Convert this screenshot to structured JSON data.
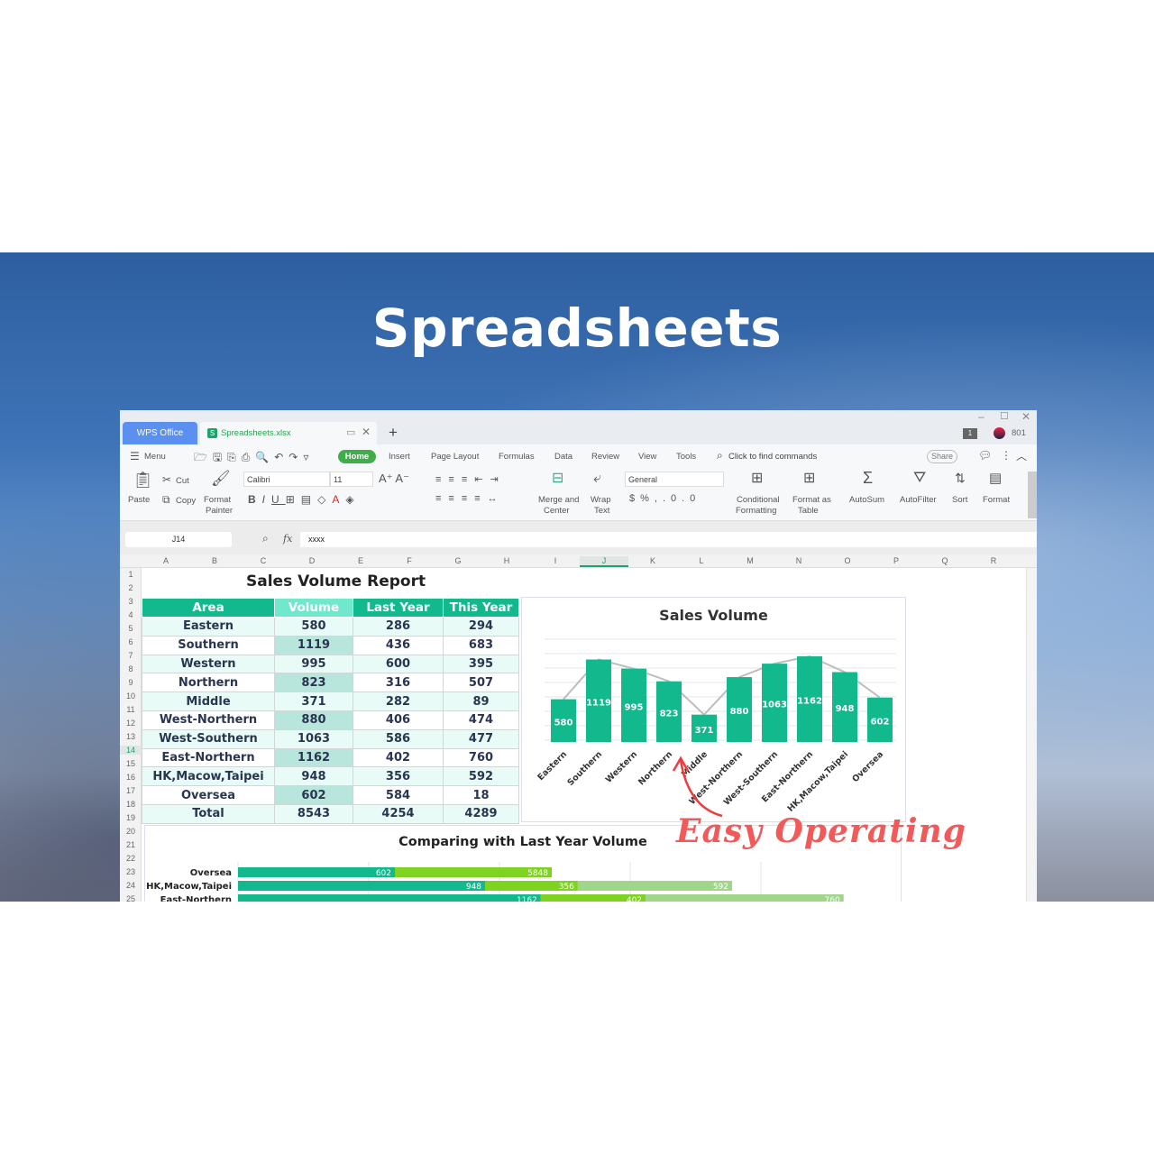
{
  "hero_title": "Spreadsheets",
  "window": {
    "tabs": {
      "home_tab": "WPS Office",
      "file_tab": "Spreadsheets.xlsx",
      "new_tab": "+"
    },
    "user_count": "801",
    "window_badge": "1",
    "menu": {
      "menu_label": "Menu",
      "items": [
        "Home",
        "Insert",
        "Page Layout",
        "Formulas",
        "Data",
        "Review",
        "View",
        "Tools"
      ],
      "active": "Home",
      "search": "Click to find commands",
      "share": "Share"
    },
    "ribbon": {
      "paste": "Paste",
      "cut": "Cut",
      "copy": "Copy",
      "format_painter": [
        "Format",
        "Painter"
      ],
      "font": "Calibri",
      "size": "11",
      "merge": [
        "Merge and",
        "Center"
      ],
      "wrap": [
        "Wrap",
        "Text"
      ],
      "number_format": "General",
      "conditional": [
        "Conditional",
        "Formatting"
      ],
      "format_table": [
        "Format as",
        "Table"
      ],
      "autosum": "AutoSum",
      "autofilter": "AutoFilter",
      "sort": "Sort",
      "format": "Format"
    },
    "formula_bar": {
      "cell_ref": "J14",
      "fx": "fx",
      "value": "xxxx"
    },
    "columns": [
      "A",
      "B",
      "C",
      "D",
      "E",
      "F",
      "G",
      "H",
      "I",
      "J",
      "K",
      "L",
      "M",
      "N",
      "O",
      "P",
      "Q",
      "R"
    ],
    "selected_column": "J",
    "selected_row": 14,
    "rows": [
      "1",
      "2",
      "3",
      "4",
      "5",
      "6",
      "7",
      "8",
      "9",
      "10",
      "11",
      "12",
      "13",
      "14",
      "15",
      "16",
      "17",
      "18",
      "19",
      "20",
      "21",
      "22",
      "23",
      "24",
      "25"
    ]
  },
  "report": {
    "title": "Sales Volume Report",
    "headers": [
      "Area",
      "Volume",
      "Last Year",
      "This Year"
    ],
    "rows": [
      [
        "Eastern",
        "580",
        "286",
        "294"
      ],
      [
        "Southern",
        "1119",
        "436",
        "683"
      ],
      [
        "Western",
        "995",
        "600",
        "395"
      ],
      [
        "Northern",
        "823",
        "316",
        "507"
      ],
      [
        "Middle",
        "371",
        "282",
        "89"
      ],
      [
        "West-Northern",
        "880",
        "406",
        "474"
      ],
      [
        "West-Southern",
        "1063",
        "586",
        "477"
      ],
      [
        "East-Northern",
        "1162",
        "402",
        "760"
      ],
      [
        "HK,Macow,Taipei",
        "948",
        "356",
        "592"
      ],
      [
        "Oversea",
        "602",
        "584",
        "18"
      ],
      [
        "Total",
        "8543",
        "4254",
        "4289"
      ]
    ]
  },
  "chart_data": [
    {
      "type": "bar",
      "title": "Sales Volume",
      "categories": [
        "Eastern",
        "Southern",
        "Western",
        "Northern",
        "Middle",
        "West-Northern",
        "West-Southern",
        "East-Northern",
        "HK,Macow,Taipei",
        "Oversea"
      ],
      "values": [
        580,
        1119,
        995,
        823,
        371,
        880,
        1063,
        1162,
        948,
        602
      ],
      "color": "#12b98c",
      "data_labels": true,
      "grid": true
    },
    {
      "type": "bar",
      "orientation": "horizontal",
      "stacked": true,
      "title": "Comparing with Last Year Volume",
      "categories": [
        "Oversea",
        "HK,Macow,Taipei",
        "East-Northern"
      ],
      "series": [
        {
          "values": [
            602,
            948,
            1162
          ],
          "color": "#12b98c"
        },
        {
          "values": [
            5848,
            356,
            402
          ],
          "color": "#7ed321"
        },
        {
          "values": [
            null,
            592,
            760
          ],
          "color": "#9fd68a"
        }
      ],
      "grid": true
    }
  ],
  "annotation": "Easy Operating",
  "colors": {
    "accent": "#12b98c",
    "tab_blue": "#5b8ff0",
    "annotation_red": "#f25a5a",
    "home_green": "#3fae49"
  }
}
